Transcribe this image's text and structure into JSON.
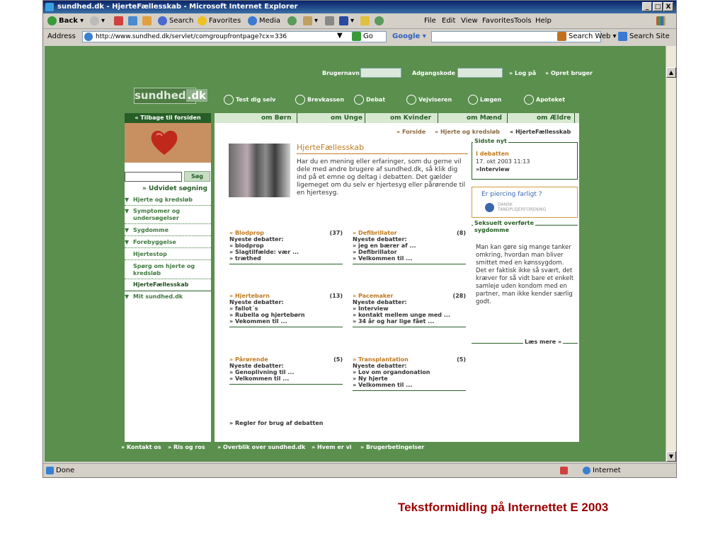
{
  "window": {
    "title": "sundhed.dk - HjerteFællesskab - Microsoft Internet Explorer",
    "controls": [
      "_",
      "□",
      "X"
    ]
  },
  "toolbar": {
    "back": "Back",
    "search": "Search",
    "favorites": "Favorites",
    "media": "Media",
    "go": "Go",
    "google": "Google",
    "file": "File",
    "edit": "Edit",
    "view": "View",
    "favorites_menu": "Favorites",
    "tools": "Tools",
    "help": "Help"
  },
  "addressbar": {
    "label": "Address",
    "url": "http://www.sundhed.dk/servlet/comgroupfrontpage?cx=336",
    "go": "Go",
    "google": "Google",
    "search_web": "Search Web",
    "search_site": "Search Site"
  },
  "site": {
    "login": {
      "user_label": "Brugernavn",
      "pass_label": "Adgangskode",
      "login": "» Log på",
      "create": "» Opret bruger"
    },
    "logo": {
      "name": "sundhed",
      "tld": ".dk"
    },
    "topnav": [
      "Test dig selv",
      "Brevkassen",
      "Debat",
      "Vejviseren",
      "Lægen",
      "Apoteket"
    ],
    "back": "« Tilbage til forsiden",
    "categories": [
      "om Børn",
      "om Unge",
      "om Kvinder",
      "om Mænd",
      "om Ældre"
    ],
    "search_button": "Søg",
    "advanced_search": "» Udvidet søgning",
    "leftnav": [
      {
        "label": "Hjerte og kredsløb",
        "tri": true
      },
      {
        "label": "Symptomer og",
        "label2": "undersøgelser",
        "tri": true
      },
      {
        "label": "Sygdomme",
        "tri": true
      },
      {
        "label": "Forebyggelse",
        "tri": true
      },
      {
        "label": "Hjertestop",
        "tri": false
      },
      {
        "label": "Spørg om hjerte og",
        "label2": "kredsløb",
        "tri": false
      },
      {
        "label": "HjerteFællesskab",
        "tri": false
      },
      {
        "label": "Mit sundhed.dk",
        "tri": true
      }
    ],
    "breadcrumb": [
      "« Forside",
      "« Hjerte og kredsløb",
      "« HjerteFællesskab"
    ],
    "heading": "HjerteFællesskab",
    "intro": "Har du en mening eller erfaringer, som du gerne vil dele med andre brugere af sundhed.dk, så klik dig ind på et emne og deltag i debatten. Det gælder ligemeget om du selv er hjertesyg eller pårørende til en hjertesyg.",
    "latest": {
      "title": "Sidste nyt",
      "line1": "I debatten",
      "line2": "17. okt 2003 11:13",
      "line3": "»Interview"
    },
    "ad": {
      "text": "Er piercing farligt ?",
      "org1": "DANSK",
      "org2": "TANDPLEJERFORENING"
    },
    "std": {
      "title1": "Seksuelt overførte",
      "title2": "sygdomme",
      "body": "Man kan gøre sig mange tanker omkring, hvordan man bliver smittet med en kønssygdom. Det er faktisk ikke så svært, det kræver for så vidt bare et enkelt samleje uden kondom med en partner, man ikke kender særlig godt.",
      "more": "Læs mere »"
    },
    "forums": [
      {
        "title": "» Blodprop",
        "count": "(37)",
        "sub": "Nyeste debatter:",
        "items": [
          "» blodprop",
          "» Slagtilfælde: vær ...",
          "» træthed"
        ]
      },
      {
        "title": "» Defibrillator",
        "count": "(8)",
        "sub": "Nyeste debatter:",
        "items": [
          "» jeg en bærer af ...",
          "» Defibrillator",
          "» Velkommen til ..."
        ]
      },
      {
        "title": "» Hjertebarn",
        "count": "(13)",
        "sub": "Nyeste debatter:",
        "items": [
          "» fallot´s",
          "» Rubella og hjertebørn",
          "» Vekommen til ..."
        ]
      },
      {
        "title": "» Pacemaker",
        "count": "(28)",
        "sub": "Nyeste debatter:",
        "items": [
          "» Interview",
          "» kontakt mellem unge med ...",
          "» 34 år og har lige fået ..."
        ]
      },
      {
        "title": "» Pårørende",
        "count": "(5)",
        "sub": "Nyeste debatter:",
        "items": [
          "» Genoplivning til ...",
          "» Velkommen til ..."
        ]
      },
      {
        "title": "» Transplantation",
        "count": "(5)",
        "sub": "Nyeste debatter:",
        "items": [
          "» Lov om organdonation",
          "» Ny hjerte",
          "» Velkommen til ..."
        ]
      }
    ],
    "rules": "» Regler for brug af debatten",
    "footer": [
      "» Kontakt os",
      "» Ris og ros",
      "» Overblik over sundhed.dk",
      "» Hvem er vi",
      "» Brugerbetingelser"
    ]
  },
  "status": {
    "left": "Done",
    "zone": "Internet"
  },
  "caption": "Tekstformidling på Internettet E 2003",
  "colors": {
    "page_green": "#5a8f4e",
    "dark_green": "#275e27",
    "orange": "#c07a20",
    "caption_red": "#9b0000"
  }
}
